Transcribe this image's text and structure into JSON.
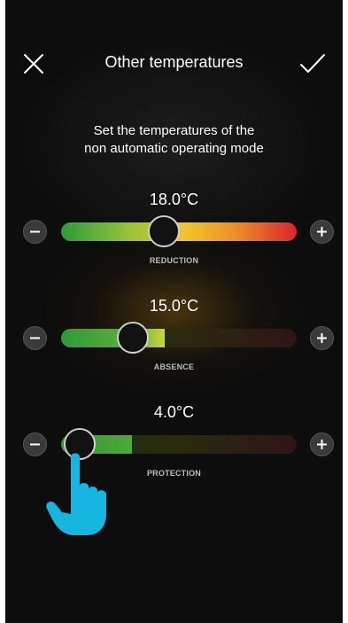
{
  "header": {
    "title": "Other temperatures",
    "close_icon": "close-icon",
    "confirm_icon": "checkmark-icon"
  },
  "subtitle": {
    "line1": "Set the temperatures of the",
    "line2": "non automatic operating mode"
  },
  "controls": [
    {
      "value": "18.0°C",
      "label": "REDUCTION",
      "level": 0.41
    },
    {
      "value": "15.0°C",
      "label": "ABSENCE",
      "level": 0.28
    },
    {
      "value": "4.0°C",
      "label": "PROTECTION",
      "level": 0.07
    }
  ],
  "icons": {
    "minus": "minus-icon",
    "plus": "plus-icon",
    "hand": "pointing-hand-icon"
  },
  "colors": {
    "background": "#0d0d0d",
    "gradient_green": "#2e9a3a",
    "gradient_yellow": "#f2c72a",
    "gradient_red": "#d8262a",
    "hand": "#17b6e0"
  }
}
